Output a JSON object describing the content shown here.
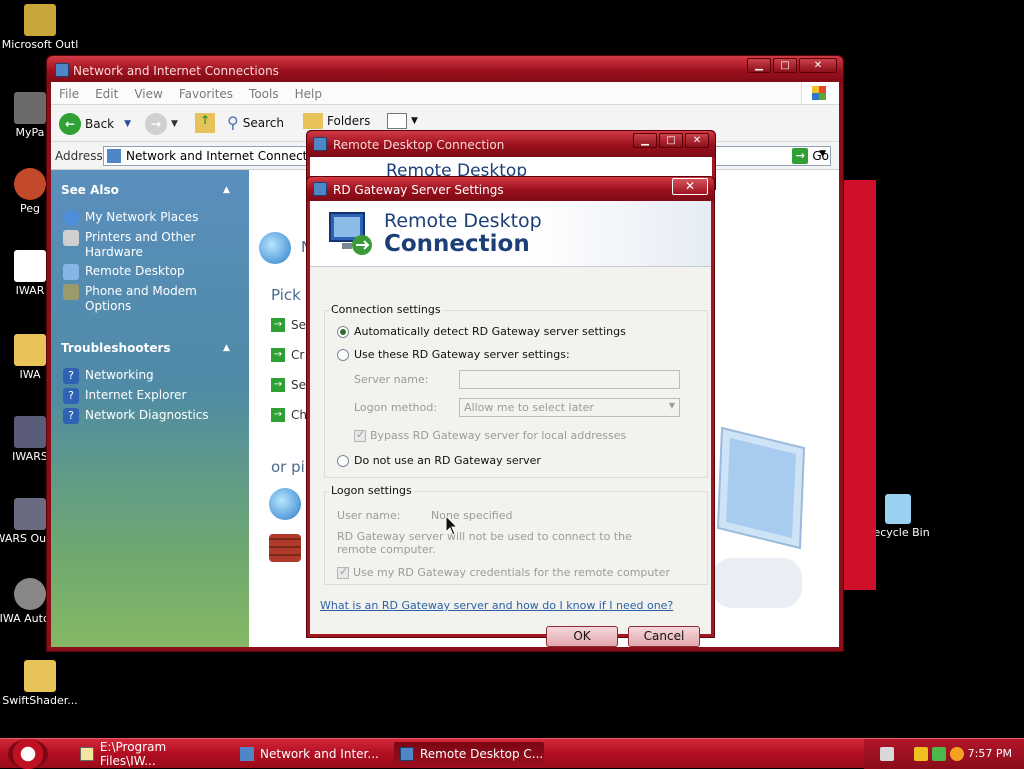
{
  "desktop": {
    "icons": [
      {
        "label": "Microsoft Outl",
        "color": "#c8a63a"
      },
      {
        "label": "MyPa",
        "color": "#6b6b6b"
      },
      {
        "label": "Peg",
        "color": "#c24a2a"
      },
      {
        "label": "IWAR",
        "color": "#ffffff"
      },
      {
        "label": "IWA",
        "color": "#e8c35a"
      },
      {
        "label": "IWARS",
        "color": "#5b5b7a"
      },
      {
        "label": "IWARS Output",
        "color": "#6a6a80"
      },
      {
        "label": "IWA Autom",
        "color": "#888888"
      },
      {
        "label": "SwiftShader...",
        "color": "#e8c35a"
      },
      {
        "label": "Recycle Bin",
        "color": "#9ad0f0"
      }
    ]
  },
  "explorer": {
    "title": "Network and Internet Connections",
    "menu": [
      "File",
      "Edit",
      "View",
      "Favorites",
      "Tools",
      "Help"
    ],
    "toolbar": {
      "back": "Back",
      "search": "Search",
      "folders": "Folders"
    },
    "address_label": "Address",
    "address_value": "Network and Internet Connections",
    "go_label": "Go",
    "see_also": {
      "heading": "See Also",
      "items": [
        "My Network Places",
        "Printers and Other Hardware",
        "Remote Desktop",
        "Phone and Modem Options"
      ]
    },
    "troubleshooters": {
      "heading": "Troubleshooters",
      "items": [
        "Networking",
        "Internet Explorer",
        "Network Diagnostics"
      ]
    },
    "content": {
      "header_partial": "N",
      "pick_partial": "Pick",
      "tasks_partial": [
        "Se",
        "Cr",
        "Se",
        "Ch"
      ],
      "or_partial": "or pi"
    }
  },
  "rdc_window": {
    "title": "Remote Desktop Connection",
    "banner_partial": "Remote Desktop"
  },
  "dialog": {
    "title": "RD Gateway Server Settings",
    "close_glyph": "✕",
    "banner_line1": "Remote Desktop",
    "banner_line2": "Connection",
    "connection_settings": {
      "title": "Connection settings",
      "auto_detect": "Automatically detect RD Gateway server settings",
      "use_these": "Use these RD Gateway server settings:",
      "server_name_label": "Server name:",
      "server_name_value": "",
      "logon_method_label": "Logon method:",
      "logon_method_value": "Allow me to select later",
      "bypass": "Bypass RD Gateway server for local addresses",
      "do_not_use": "Do not use an RD Gateway server"
    },
    "logon_settings": {
      "title": "Logon settings",
      "user_name_label": "User name:",
      "user_name_value": "None specified",
      "info": "RD Gateway server will not be used to connect to the remote computer.",
      "use_credentials": "Use my RD Gateway credentials for the remote computer"
    },
    "help_link": "What is an RD Gateway server and how do I know if I need one?",
    "ok": "OK",
    "cancel": "Cancel"
  },
  "taskbar": {
    "items": [
      "E:\\Program Files\\IW...",
      "Network and Inter...",
      "Remote Desktop C..."
    ],
    "clock": "7:57 PM"
  }
}
